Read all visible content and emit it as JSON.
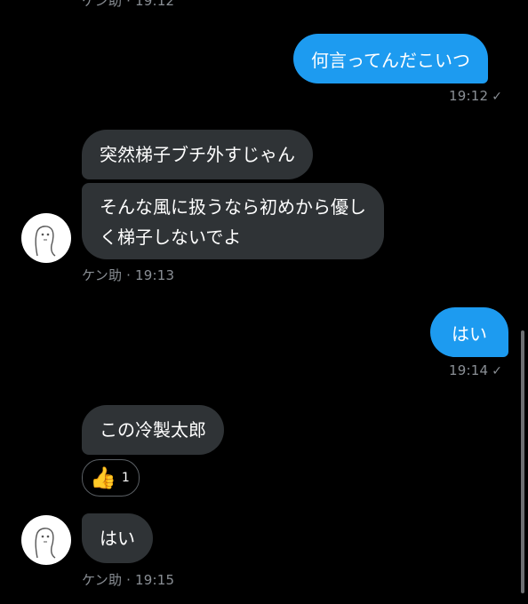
{
  "conversation": {
    "top_cut_meta": "ケン助 · 19:12",
    "messages": [
      {
        "dir": "out",
        "text": "何言ってんだこいつ",
        "time": "19:12"
      },
      {
        "dir": "in",
        "text": "突然梯子ブチ外すじゃん"
      },
      {
        "dir": "in",
        "text_line1": "そんな風に扱うなら初めから優し",
        "text_line2": "く梯子しないでよ"
      },
      {
        "dir": "in_meta",
        "meta": "ケン助 · 19:13"
      },
      {
        "dir": "out",
        "text": "はい",
        "time": "19:14"
      },
      {
        "dir": "in",
        "text": "この冷製太郎",
        "reaction": {
          "emoji": "👍",
          "count": "1"
        }
      },
      {
        "dir": "in",
        "text": "はい",
        "meta": "ケン助 · 19:15"
      }
    ]
  },
  "icons": {
    "read_check": "checkmark-icon",
    "avatar": "avatar-icon"
  },
  "colors": {
    "background": "#000000",
    "incoming_bubble": "#2f3336",
    "outgoing_bubble": "#1d9bf0",
    "meta_text": "#8a8f95"
  }
}
